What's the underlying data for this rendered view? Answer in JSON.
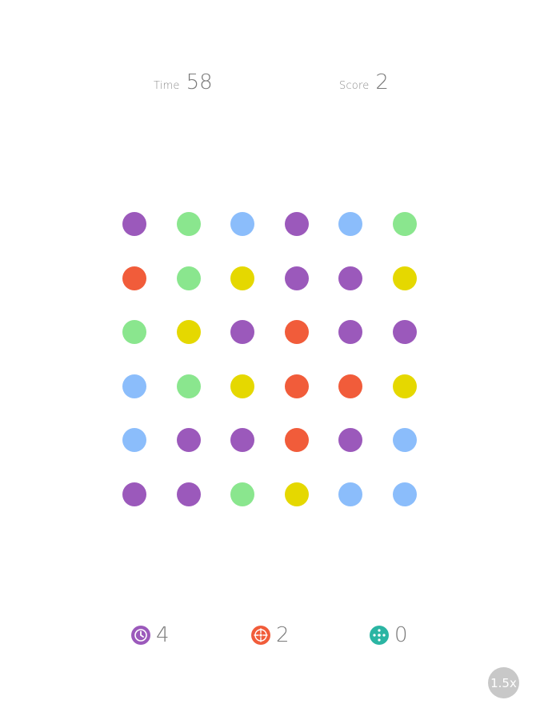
{
  "hud": {
    "time_label": "Time",
    "time_value": "58",
    "score_label": "Score",
    "score_value": "2"
  },
  "colors": {
    "purple": "#9b59bb",
    "green": "#8ae68e",
    "blue": "#8bbdfb",
    "red": "#f15c3a",
    "yellow": "#e5d800",
    "teal": "#2bb5a3"
  },
  "board": {
    "rows": [
      [
        "purple",
        "green",
        "blue",
        "purple",
        "blue",
        "green"
      ],
      [
        "red",
        "green",
        "yellow",
        "purple",
        "purple",
        "yellow"
      ],
      [
        "green",
        "yellow",
        "purple",
        "red",
        "purple",
        "purple"
      ],
      [
        "blue",
        "green",
        "yellow",
        "red",
        "red",
        "yellow"
      ],
      [
        "blue",
        "purple",
        "purple",
        "red",
        "purple",
        "blue"
      ],
      [
        "purple",
        "purple",
        "green",
        "yellow",
        "blue",
        "blue"
      ]
    ]
  },
  "powerups": {
    "time_stop": {
      "icon": "clock-icon",
      "color": "#9b59bb",
      "count": "4"
    },
    "shrinker": {
      "icon": "shrinker-icon",
      "color": "#f15c3a",
      "count": "2"
    },
    "expander": {
      "icon": "expander-icon",
      "color": "#2bb5a3",
      "count": "0"
    }
  },
  "speed": {
    "label": "1.5x"
  }
}
